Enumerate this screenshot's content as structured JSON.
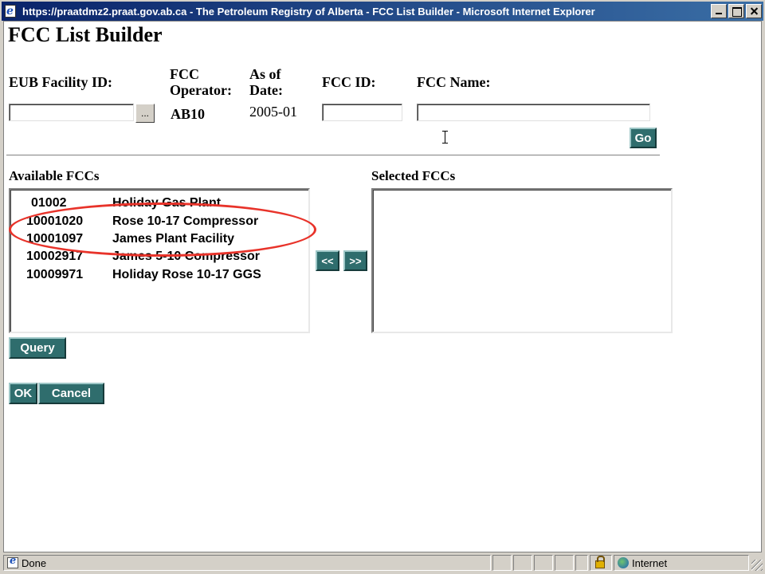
{
  "window": {
    "title": "https://praatdmz2.praat.gov.ab.ca - The Petroleum Registry of Alberta - FCC List Builder - Microsoft Internet Explorer"
  },
  "page": {
    "title": "FCC List Builder"
  },
  "form": {
    "eub_facility_id_label": "EUB Facility ID:",
    "eub_facility_id_value": "",
    "browse_label": "...",
    "fcc_operator_label_line1": "FCC",
    "fcc_operator_label_line2": "Operator:",
    "fcc_operator_value": "AB10",
    "as_of_date_label_line1": "As of",
    "as_of_date_label_line2": "Date:",
    "as_of_date_value": "2005-01",
    "fcc_id_label": "FCC ID:",
    "fcc_id_value": "",
    "fcc_name_label": "FCC Name:",
    "fcc_name_value": "",
    "go_label": "Go"
  },
  "available": {
    "label": "Available FCCs",
    "items": [
      {
        "id": "01002",
        "name": "Holiday Gas Plant"
      },
      {
        "id": "10001020",
        "name": "Rose 10-17 Compressor"
      },
      {
        "id": "10001097",
        "name": "James Plant Facility"
      },
      {
        "id": "10002917",
        "name": "James 5-10 Compressor"
      },
      {
        "id": "10009971",
        "name": "Holiday Rose 10-17 GGS"
      }
    ]
  },
  "selected": {
    "label": "Selected FCCs",
    "items": []
  },
  "buttons": {
    "remove_label": "<<",
    "add_label": ">>",
    "query_label": "Query",
    "ok_label": "OK",
    "cancel_label": "Cancel"
  },
  "statusbar": {
    "status": "Done",
    "zone": "Internet"
  },
  "colors": {
    "button_bg": "#2f6d6d",
    "highlight_oval": "#e8332a",
    "titlebar": "#0a246a"
  }
}
